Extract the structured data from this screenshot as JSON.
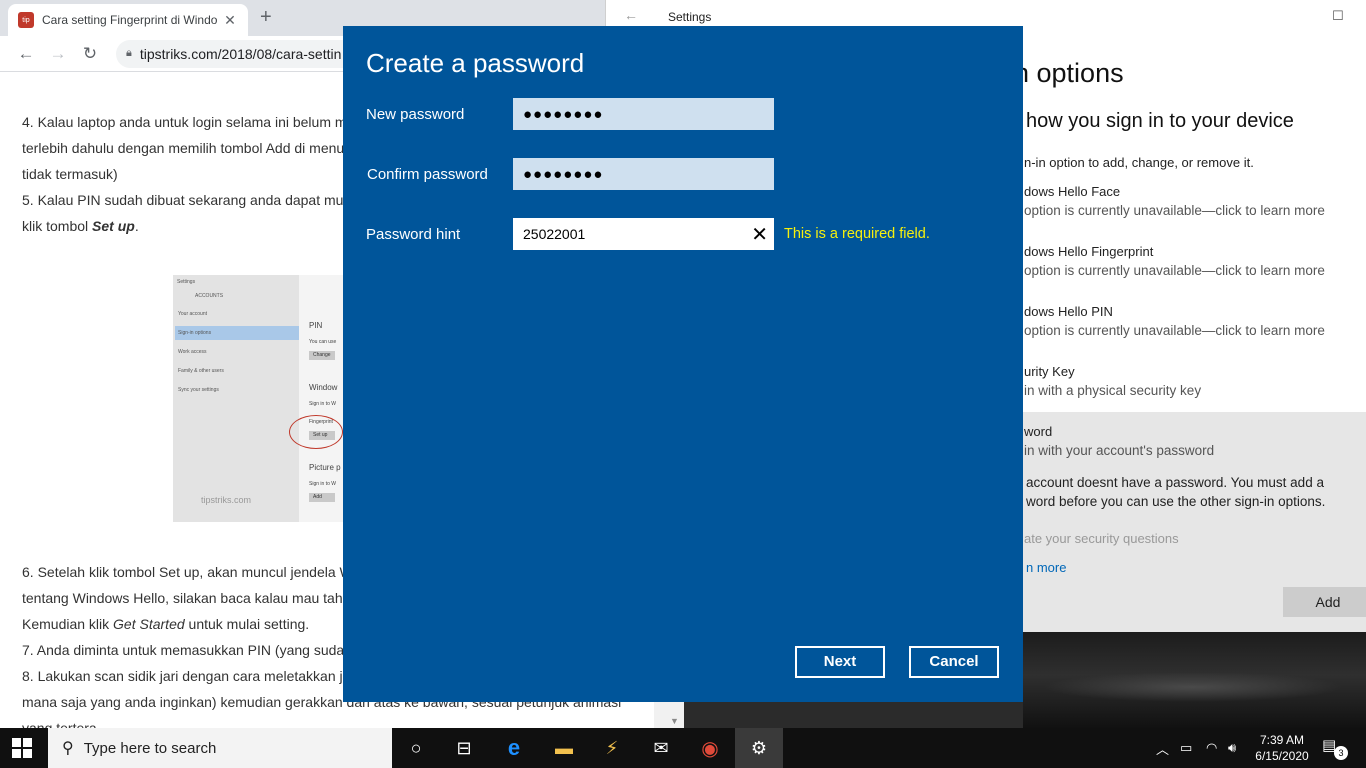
{
  "browser": {
    "tab_title": "Cara setting Fingerprint di Windo",
    "tab_close": "✕",
    "new_tab": "+",
    "url": "tipstriks.com/2018/08/cara-settin",
    "article": {
      "line1": "4. Kalau laptop anda untuk login selama ini belum m",
      "line2": "terlebih dahulu dengan memilih tombol Add di menu",
      "line3": "tidak termasuk)",
      "line4": "5. Kalau PIN sudah dibuat sekarang anda dapat mul",
      "line5_pre": "klik tombol ",
      "line5_em": "Set up",
      "line5_post": ".",
      "line6": " 6. Setelah klik tombol Set up, akan muncul jendela W",
      "line7": "tentang Windows Hello, silakan baca kalau mau tah",
      "line8_pre": "Kemudian klik ",
      "line8_em": "Get Started",
      "line8_post": " untuk mulai setting.",
      "line9": "7. Anda diminta untuk memasukkan PIN (yang suda",
      "line10": "8. Lakukan scan sidik jari dengan cara meletakkan ja",
      "line11": "mana saja yang anda inginkan) kemudian gerakkan dari atas ke bawah, sesuai petunjuk animasi",
      "line12": "yang tertera"
    },
    "image": {
      "header": "Settings",
      "section": "ACCOUNTS",
      "sidebar": [
        "Your account",
        "Sign-in options",
        "Work access",
        "Family & other users",
        "Sync your settings"
      ],
      "main_pin": "PIN",
      "main_pin_sub": "You can use",
      "main_change": "Change",
      "main_windows": "Window",
      "main_signin": "Sign in to W",
      "main_fingerprint": "Fingerprint",
      "main_setup": "Set up",
      "main_picture": "Picture p",
      "main_signin2": "Sign in to W",
      "main_add": "Add",
      "watermark": "tipstriks.com"
    }
  },
  "settings": {
    "window_title": "Settings",
    "heading": "n options",
    "subheading": "how you sign in to your device",
    "intro": "n-in option to add, change, or remove it.",
    "options": [
      {
        "name": "dows Hello Face",
        "desc": "option is currently unavailable—click to learn more"
      },
      {
        "name": "dows Hello Fingerprint",
        "desc": "option is currently unavailable—click to learn more"
      },
      {
        "name": "dows Hello PIN",
        "desc": "option is currently unavailable—click to learn more"
      },
      {
        "name": "urity Key",
        "desc": "in with a physical security key"
      },
      {
        "name": "word",
        "desc": "in with your account's password"
      }
    ],
    "password_note_1": "account doesnt have a password. You must add a",
    "password_note_2": "word before you can use the other sign-in options.",
    "security_questions": "ate your security questions",
    "learn_more": "n more",
    "add_button": "Add"
  },
  "dialog": {
    "title": "Create a password",
    "new_password_label": "New password",
    "new_password_value": "●●●●●●●●",
    "confirm_password_label": "Confirm password",
    "confirm_password_value": "●●●●●●●●",
    "hint_label": "Password hint",
    "hint_value": "25022001",
    "clear_icon": "✕",
    "error_text": "This is a required field.",
    "next_button": "Next",
    "cancel_button": "Cancel"
  },
  "taskbar": {
    "search_placeholder": "Type here to search",
    "time": "7:39 AM",
    "date": "6/15/2020",
    "notification_count": "3"
  },
  "colors": {
    "dialog_bg": "#00559a",
    "error": "#f6f00d",
    "link": "#0067b8"
  }
}
